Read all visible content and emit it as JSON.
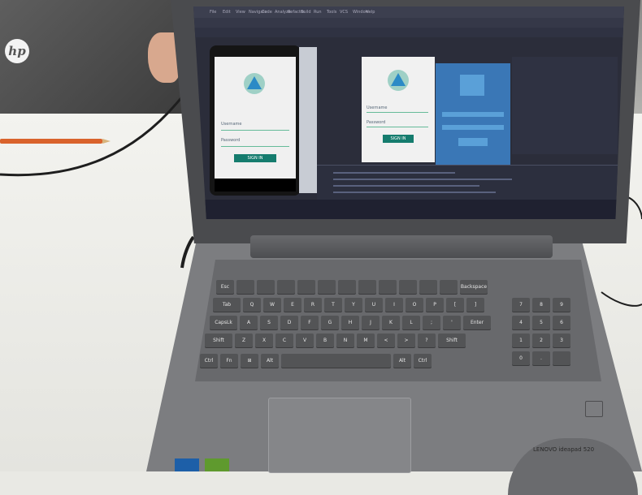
{
  "scene": {
    "monitor_logo": "hp",
    "colors": {
      "desk": "#ecece8",
      "laptop": "#7c7d80",
      "screen_bg": "#2b2d3a",
      "accent_teal": "#157c6e",
      "blueprint_blue": "#3a77b6",
      "pencil": "#d9632c"
    }
  },
  "ide": {
    "menu_items": [
      "File",
      "Edit",
      "View",
      "Navigate",
      "Code",
      "Analyze",
      "Refactor",
      "Build",
      "Run",
      "Tools",
      "VCS",
      "Window",
      "Help"
    ]
  },
  "app_preview": {
    "username_label": "Username",
    "password_label": "Password",
    "sign_in_button": "SIGN IN"
  },
  "phone_preview": {
    "username_label": "Username",
    "password_label": "Password",
    "sign_in_button": "SIGN IN"
  },
  "laptop": {
    "brand_text": "LENOVO ideapad 520",
    "keys_row1": [
      "Esc",
      "",
      "",
      "",
      "",
      "",
      "",
      "",
      "",
      "",
      "",
      "",
      "Backspace"
    ],
    "keys_row2": [
      "Tab",
      "Q",
      "W",
      "E",
      "R",
      "T",
      "Y",
      "U",
      "I",
      "O",
      "P",
      "[",
      "]"
    ],
    "keys_row3": [
      "CapsLk",
      "A",
      "S",
      "D",
      "F",
      "G",
      "H",
      "J",
      "K",
      "L",
      ";",
      "'",
      "Enter"
    ],
    "keys_row4": [
      "Shift",
      "Z",
      "X",
      "C",
      "V",
      "B",
      "N",
      "M",
      "<",
      ">",
      "?",
      "Shift"
    ],
    "keys_row5": [
      "Ctrl",
      "Fn",
      "⊞",
      "Alt",
      "",
      "Alt",
      "Ctrl"
    ]
  }
}
